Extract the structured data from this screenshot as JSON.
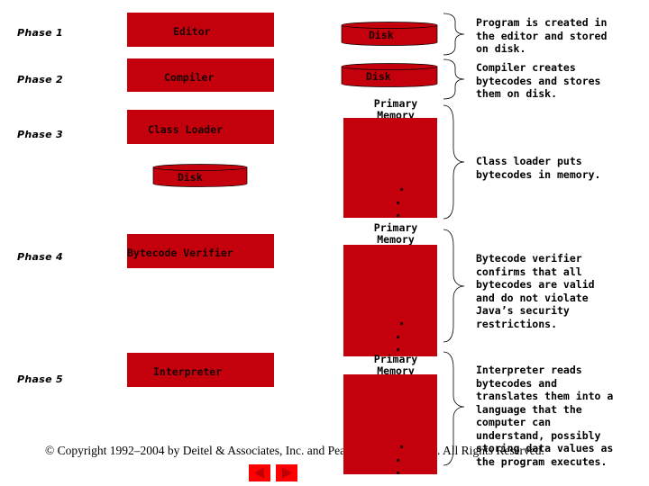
{
  "phases": [
    "Phase 1",
    "Phase 2",
    "Phase 3",
    "Phase 4",
    "Phase 5"
  ],
  "components": {
    "editor": "Editor",
    "compiler": "Compiler",
    "class_loader": "Class Loader",
    "bytecode_verifier": "Bytecode Verifier",
    "interpreter": "Interpreter"
  },
  "disks": [
    "Disk",
    "Disk",
    "Disk"
  ],
  "memory_label": "Primary Memory",
  "memory_label_line1": "Primary",
  "memory_label_line2": "Memory",
  "descriptions": [
    "Program is created in\nthe editor and stored\non disk.",
    "Compiler creates\nbytecodes and stores\nthem on disk.",
    "Class loader puts\nbytecodes in memory.",
    "Bytecode verifier\nconfirms that all\nbytecodes are valid\nand do not violate\nJava’s security\nrestrictions.",
    "Interpreter reads\nbytecodes and\ntranslates them into a\nlanguage that the\ncomputer can\nunderstand, possibly\nstoring data values as\nthe program executes."
  ],
  "copyright": "© Copyright 1992–2004 by Deitel & Associates, Inc. and Pearson Education Inc. All Rights Reserved.",
  "nav": {
    "prev_icon": "triangle-left",
    "next_icon": "triangle-right"
  },
  "colors": {
    "box_red": "#c4000c",
    "nav_red": "#ff0000",
    "nav_arrow": "#c00000"
  }
}
